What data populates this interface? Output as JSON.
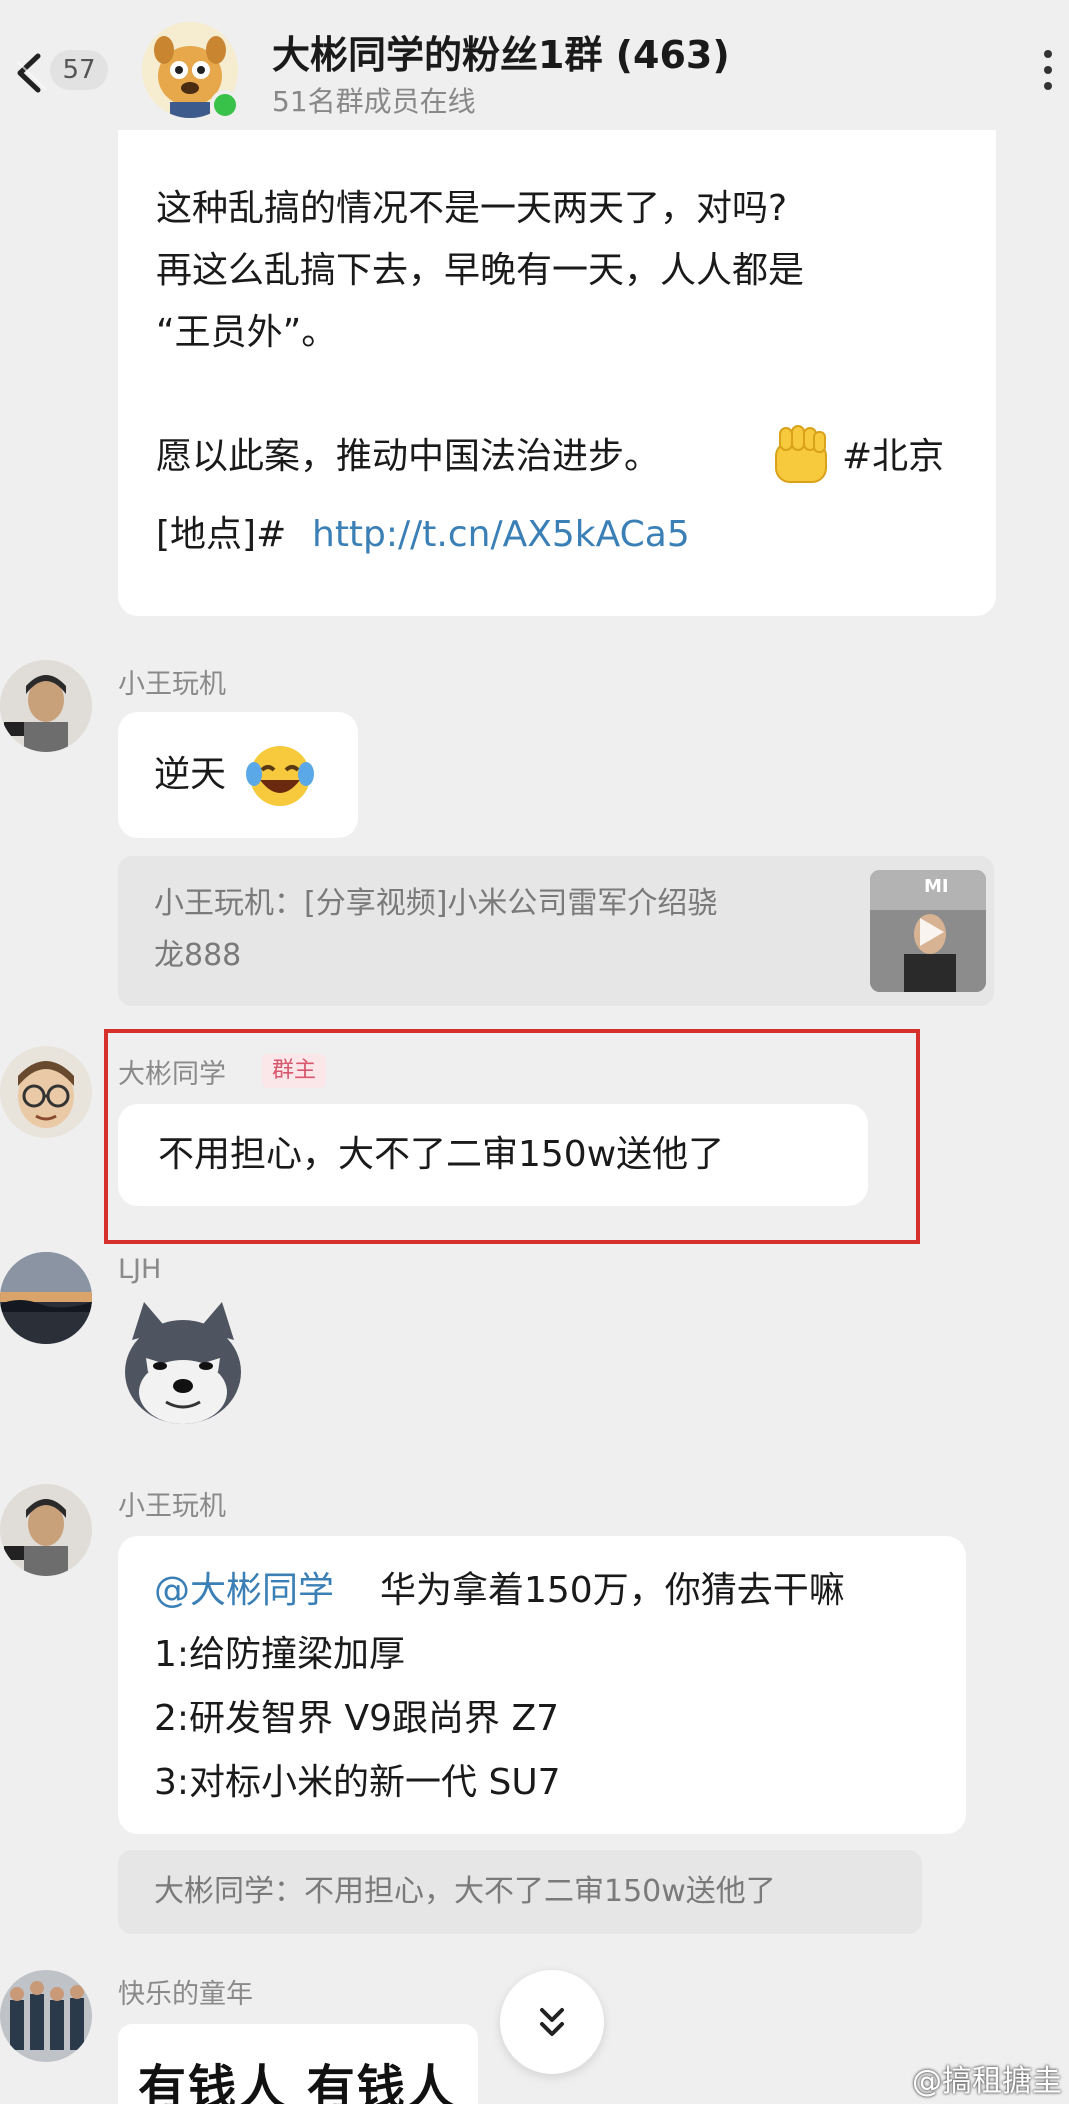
{
  "header": {
    "unread_count": "57",
    "group_name": "大彬同学的粉丝1群 (463)",
    "online_status": "51名群成员在线"
  },
  "messages": [
    {
      "lines": [
        "这种乱搞的情况不是一天两天了，对吗?",
        "再这么乱搞下去，早晚有一天，人人都是",
        "“王员外”。",
        "",
        "愿以此案，推动中国法治进步。"
      ],
      "tag_text": "#北京",
      "tag_line2_prefix": "[地点]#",
      "link": "http://t.cn/AX5kACa5"
    },
    {
      "sender": "小王玩机",
      "text": "逆天",
      "quote_line1": "小王玩机：[分享视频]小米公司雷军介绍骁",
      "quote_line2": "龙888",
      "thumb_logo": "MI"
    },
    {
      "sender": "大彬同学",
      "badge": "群主",
      "text": "不用担心，大不了二审150w送他了"
    },
    {
      "sender": "LJH"
    },
    {
      "sender": "小王玩机",
      "mention": "@大彬同学",
      "line1_rest": "华为拿着150万，你猜去干嘛",
      "line2": "1:给防撞梁加厚",
      "line3": "2:研发智界 V9跟尚界 Z7",
      "line4": "3:对标小米的新一代 SU7",
      "quote": "大彬同学：不用担心，大不了二审150w送他了"
    },
    {
      "sender": "快乐的童年",
      "image_text": "有钱人  有钱人"
    }
  ],
  "watermark": "@搞租搪圭",
  "colors": {
    "background": "#efefef",
    "link": "#3a7fb5",
    "highlight_border": "#d6302c",
    "online_dot": "#38c24a",
    "owner_badge": "#d7576c"
  }
}
